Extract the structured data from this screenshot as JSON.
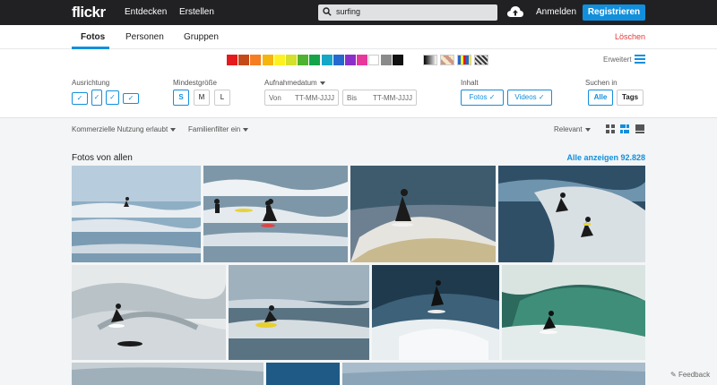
{
  "header": {
    "logo": "flickr",
    "nav": [
      "Entdecken",
      "Erstellen"
    ],
    "search_value": "surfing",
    "login": "Anmelden",
    "register": "Registrieren"
  },
  "tabs": [
    "Fotos",
    "Personen",
    "Gruppen"
  ],
  "clear": "Löschen",
  "colors": [
    "#e41a1c",
    "#c44a18",
    "#f57e20",
    "#f6b40e",
    "#fdf21f",
    "#d4e02a",
    "#4fb230",
    "#16a34a",
    "#13a7c8",
    "#2468d0",
    "#8a2fc9",
    "#e6399b",
    "#ffffff",
    "#8a8a8a",
    "#111111"
  ],
  "advanced": "Erweitert",
  "filters": {
    "orientation_label": "Ausrichtung",
    "size_label": "Mindestgröße",
    "sizes": [
      "S",
      "M",
      "L"
    ],
    "date_label": "Aufnahmedatum",
    "date_from_label": "Von",
    "date_to_label": "Bis",
    "date_placeholder": "TT-MM-JJJJ",
    "content_label": "Inhalt",
    "content_photos": "Fotos",
    "content_videos": "Videos",
    "search_in_label": "Suchen in",
    "search_all": "Alle",
    "search_tags": "Tags"
  },
  "subbar": {
    "commercial": "Kommerzielle Nutzung erlaubt",
    "family": "Familienfilter ein",
    "sort": "Relevant"
  },
  "results": {
    "title": "Fotos von allen",
    "see_all": "Alle anzeigen 92.828"
  },
  "feedback": "Feedback"
}
